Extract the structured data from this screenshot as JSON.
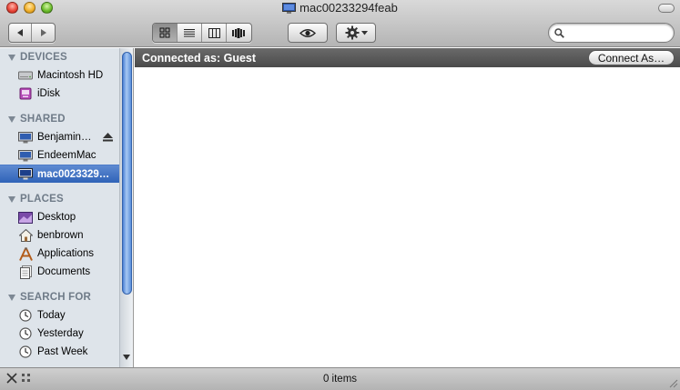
{
  "window": {
    "title": "mac00233294feab"
  },
  "toolbar": {
    "nav": [
      {
        "name": "back-button",
        "icon": "triangle-left-icon"
      },
      {
        "name": "forward-button",
        "icon": "triangle-right-icon"
      }
    ],
    "views": [
      {
        "name": "icon-view-button",
        "icon": "grid-icon",
        "active": true
      },
      {
        "name": "list-view-button",
        "icon": "list-icon",
        "active": false
      },
      {
        "name": "column-view-button",
        "icon": "columns-icon",
        "active": false
      },
      {
        "name": "coverflow-view-button",
        "icon": "coverflow-icon",
        "active": false
      }
    ],
    "quicklook_icon": "eye-icon",
    "action_icon": "gear-icon",
    "search": {
      "value": "",
      "placeholder": ""
    }
  },
  "sidebar": {
    "sections": [
      {
        "label": "DEVICES",
        "items": [
          {
            "label": "Macintosh HD",
            "icon": "hard-drive-icon"
          },
          {
            "label": "iDisk",
            "icon": "idisk-icon"
          }
        ]
      },
      {
        "label": "SHARED",
        "items": [
          {
            "label": "Benjamin…",
            "icon": "computer-icon",
            "eject": true
          },
          {
            "label": "EndeemMac",
            "icon": "computer-icon"
          },
          {
            "label": "mac0023329…",
            "icon": "computer-icon",
            "selected": true
          }
        ]
      },
      {
        "label": "PLACES",
        "items": [
          {
            "label": "Desktop",
            "icon": "desktop-icon"
          },
          {
            "label": "benbrown",
            "icon": "home-icon"
          },
          {
            "label": "Applications",
            "icon": "applications-icon"
          },
          {
            "label": "Documents",
            "icon": "documents-icon"
          }
        ]
      },
      {
        "label": "SEARCH FOR",
        "items": [
          {
            "label": "Today",
            "icon": "clock-icon"
          },
          {
            "label": "Yesterday",
            "icon": "clock-icon"
          },
          {
            "label": "Past Week",
            "icon": "clock-icon"
          }
        ]
      }
    ]
  },
  "main": {
    "connected_label": "Connected as: Guest",
    "connect_button": "Connect As…"
  },
  "status": {
    "items_label": "0 items"
  },
  "colors": {
    "selection": "#3a6fc4",
    "sidebar_bg": "#dee4ea",
    "connect_bar": "#555555"
  }
}
